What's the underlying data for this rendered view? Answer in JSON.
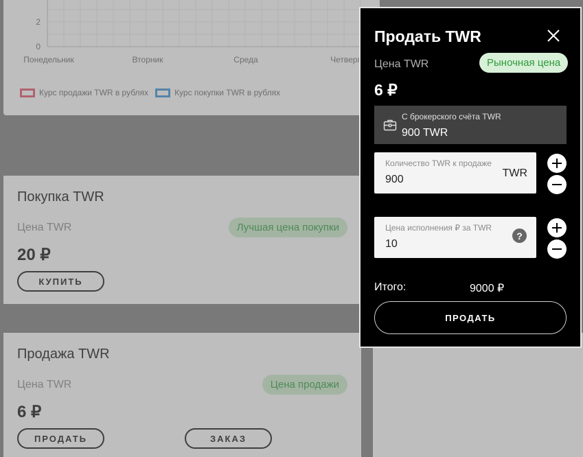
{
  "chart": {
    "y_ticks": [
      "2",
      "0"
    ],
    "x_labels": [
      "Понедельник",
      "Вторник",
      "Среда",
      "Четверг"
    ],
    "legend": [
      {
        "label": "Курс продажи TWR в рублях",
        "color": "#e0506a"
      },
      {
        "label": "Курс покупки TWR в рублях",
        "color": "#3a8fd0"
      }
    ]
  },
  "chart_data": {
    "type": "line",
    "categories": [
      "Понедельник",
      "Вторник",
      "Среда",
      "Четверг"
    ],
    "series": [
      {
        "name": "Курс продажи TWR в рублях",
        "values": [],
        "color": "#e0506a"
      },
      {
        "name": "Курс покупки TWR в рублях",
        "values": [],
        "color": "#3a8fd0"
      }
    ],
    "y_ticks": [
      0,
      2
    ],
    "grid": true,
    "legend": "bottom-left"
  },
  "buy_card": {
    "title": "Покупка TWR",
    "price_label": "Цена TWR",
    "badge": "Лучшая цена покупки",
    "price": "20 ₽",
    "buy_button": "КУПИТЬ"
  },
  "sell_card": {
    "title": "Продажа TWR",
    "price_label": "Цена TWR",
    "badge": "Цена продажи",
    "price": "6 ₽",
    "sell_button": "ПРОДАТЬ",
    "order_button": "ЗАКАЗ"
  },
  "modal": {
    "title": "Продать TWR",
    "close_icon": "close-icon",
    "price_label": "Цена TWR",
    "market_badge": "Рыночная цена",
    "price": "6 ₽",
    "broker": {
      "label": "С брокерского счёта TWR",
      "value": "900 TWR",
      "icon": "briefcase-icon"
    },
    "quantity": {
      "label": "Количество TWR к продаже",
      "value": "900",
      "unit": "TWR"
    },
    "exec_price": {
      "label": "Цена исполнения ₽ за TWR",
      "value": "10",
      "help": "?"
    },
    "total_label": "Итого:",
    "total_value": "9000 ₽",
    "sell_button": "ПРОДАТЬ"
  }
}
